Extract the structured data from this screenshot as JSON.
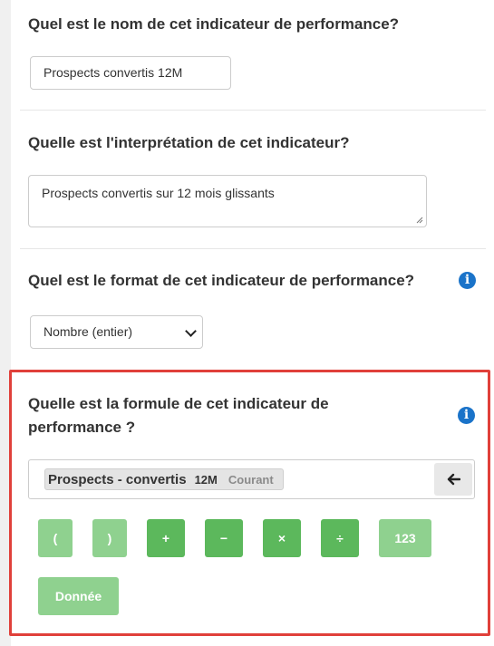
{
  "q_name": {
    "title": "Quel est le nom de cet indicateur de performance?",
    "value": "Prospects convertis 12M"
  },
  "q_interp": {
    "title": "Quelle est l'interprétation de cet indicateur?",
    "value": "Prospects convertis sur 12 mois glissants"
  },
  "q_format": {
    "title": "Quel est le format de cet indicateur de performance?",
    "selected": "Nombre (entier)"
  },
  "q_formula": {
    "title_line1": "Quelle est la formule de cet indicateur de",
    "title_line2": "performance ?",
    "token": {
      "name": "Prospects - convertis",
      "period": "12M",
      "course": "Courant"
    },
    "back_symbol": "🡐",
    "operators": [
      "(",
      ")",
      "+",
      "−",
      "×",
      "÷",
      "123"
    ],
    "data_button": "Donnée"
  },
  "colors": {
    "highlight_border": "#e0403a",
    "info_icon": "#1a73c9",
    "button_green": "#5cb85c",
    "button_green_light": "#8fd18f"
  },
  "icons": {
    "info": "info-circle-icon",
    "back": "arrow-left-icon",
    "chevron": "chevron-down-icon"
  }
}
